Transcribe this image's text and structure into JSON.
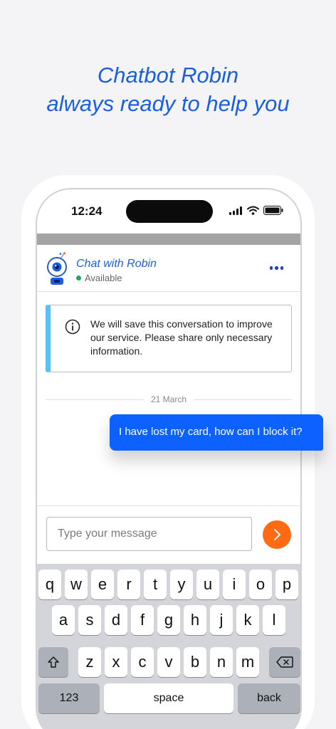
{
  "headline": {
    "line1": "Chatbot Robin",
    "line2": "always ready to help you"
  },
  "status_bar": {
    "time": "12:24"
  },
  "chat_header": {
    "title": "Chat with Robin",
    "status": "Available",
    "status_color": "#1fa65a"
  },
  "info_notice": {
    "icon": "info-icon",
    "text": "We will save this conversation to improve our service. Please share only necessary information."
  },
  "date_separator": "21 March",
  "messages": [
    {
      "sender": "user",
      "text": "I have lost my card, how can I block it?"
    }
  ],
  "composer": {
    "placeholder": "Type your message",
    "value": "",
    "send_icon": "chevron-right-icon"
  },
  "keyboard": {
    "row1": [
      "q",
      "w",
      "e",
      "r",
      "t",
      "y",
      "u",
      "i",
      "o",
      "p"
    ],
    "row2": [
      "a",
      "s",
      "d",
      "f",
      "g",
      "h",
      "j",
      "k",
      "l"
    ],
    "row3": [
      "z",
      "x",
      "c",
      "v",
      "b",
      "n",
      "m"
    ],
    "shift_icon": "shift-icon",
    "backspace_icon": "backspace-icon",
    "numbers_label": "123",
    "space_label": "space",
    "return_label": "back"
  },
  "colors": {
    "accent": "#1a5fe0",
    "bubble": "#0c61ff",
    "send": "#ff6a13",
    "info_bar": "#5cc0f4"
  }
}
